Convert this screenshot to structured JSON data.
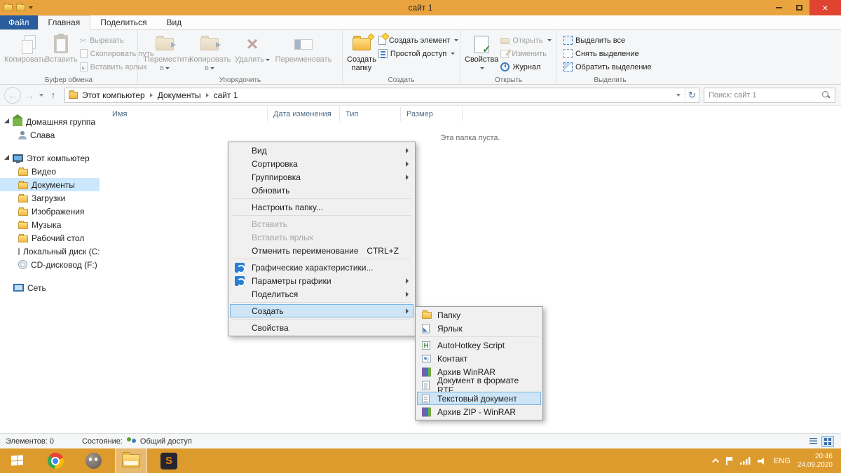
{
  "colors": {
    "titlebar_orange": "#e9a43f",
    "taskbar_orange": "#dd9a2d",
    "close_red": "#e0432f",
    "file_tab_blue": "#2a5d9e",
    "selection_blue": "#cce8ff",
    "menu_highlight_blue": "#cde5f7"
  },
  "window": {
    "title": "сайт 1"
  },
  "tabs": {
    "file": "Файл",
    "home": "Главная",
    "share": "Поделиться",
    "view": "Вид"
  },
  "ribbon": {
    "clipboard": {
      "copy": "Копировать",
      "paste": "Вставить",
      "cut": "Вырезать",
      "copy_path": "Скопировать путь",
      "paste_shortcut": "Вставить ярлык",
      "group": "Буфер обмена"
    },
    "organize": {
      "move_to": "Переместить в",
      "copy_to": "Копировать в",
      "delete": "Удалить",
      "rename": "Переименовать",
      "group": "Упорядочить"
    },
    "create": {
      "new_folder": "Создать папку",
      "new_item": "Создать элемент",
      "easy_access": "Простой доступ",
      "group": "Создать"
    },
    "open": {
      "properties": "Свойства",
      "open": "Открыть",
      "edit": "Изменить",
      "history": "Журнал",
      "group": "Открыть"
    },
    "select": {
      "select_all": "Выделить все",
      "select_none": "Снять выделение",
      "invert_selection": "Обратить выделение",
      "group": "Выделить"
    }
  },
  "address": {
    "crumbs": [
      "Этот компьютер",
      "Документы",
      "сайт 1"
    ],
    "search_placeholder": "Поиск: сайт 1"
  },
  "columns": {
    "name": "Имя",
    "date": "Дата изменения",
    "type": "Тип",
    "size": "Размер"
  },
  "content": {
    "empty_message": "Эта папка пуста."
  },
  "sidebar": {
    "items": [
      {
        "label": "Домашняя группа"
      },
      {
        "label": "Слава"
      },
      {
        "label": "Этот компьютер"
      },
      {
        "label": "Видео"
      },
      {
        "label": "Документы"
      },
      {
        "label": "Загрузки"
      },
      {
        "label": "Изображения"
      },
      {
        "label": "Музыка"
      },
      {
        "label": "Рабочий стол"
      },
      {
        "label": "Локальный диск (C:"
      },
      {
        "label": "CD-дисковод (F:)"
      },
      {
        "label": "Сеть"
      }
    ]
  },
  "context_menu": {
    "items": [
      {
        "label": "Вид"
      },
      {
        "label": "Сортировка"
      },
      {
        "label": "Группировка"
      },
      {
        "label": "Обновить"
      },
      {
        "label": "Настроить папку..."
      },
      {
        "label": "Вставить"
      },
      {
        "label": "Вставить ярлык"
      },
      {
        "label": "Отменить переименование",
        "shortcut": "CTRL+Z"
      },
      {
        "label": "Графические характеристики..."
      },
      {
        "label": "Параметры графики"
      },
      {
        "label": "Поделиться"
      },
      {
        "label": "Создать"
      },
      {
        "label": "Свойства"
      }
    ]
  },
  "submenu": {
    "items": [
      {
        "label": "Папку"
      },
      {
        "label": "Ярлык"
      },
      {
        "label": "AutoHotkey Script"
      },
      {
        "label": "Контакт"
      },
      {
        "label": "Архив WinRAR"
      },
      {
        "label": "Документ в формате RTF"
      },
      {
        "label": "Текстовый документ"
      },
      {
        "label": "Архив ZIP - WinRAR"
      }
    ]
  },
  "statusbar": {
    "items_count": "Элементов: 0",
    "state_label": "Состояние:",
    "state_value": "Общий доступ"
  },
  "taskbar": {
    "lang": "ENG",
    "time": "20:46",
    "date": "24.09.2020"
  }
}
